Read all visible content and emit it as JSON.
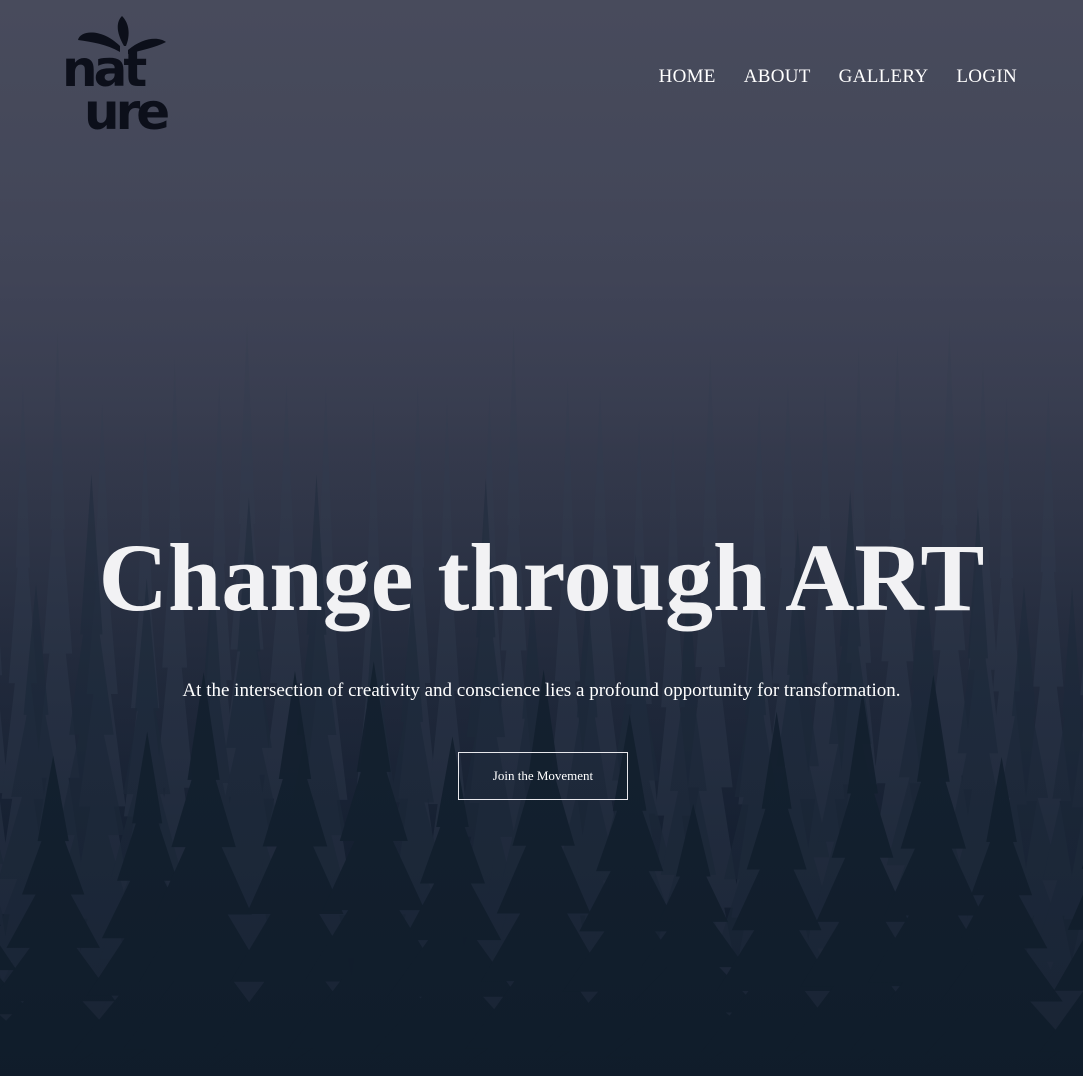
{
  "brand": {
    "logo_text_top": "nat",
    "logo_text_bottom": "ure",
    "logo_icon": "leaf-sprout-icon",
    "logo_color": "#0c0f1a"
  },
  "nav": {
    "items": [
      {
        "label": "HOME"
      },
      {
        "label": "ABOUT"
      },
      {
        "label": "GALLERY"
      },
      {
        "label": "LOGIN"
      }
    ]
  },
  "hero": {
    "headline": "Change through ART",
    "subline": "At the intersection of creativity and conscience lies a profound opportunity for transformation.",
    "cta_label": "Join the Movement"
  },
  "colors": {
    "sky_top": "#484b5c",
    "forest_bottom": "#0f1a2b",
    "text": "#ffffff"
  }
}
